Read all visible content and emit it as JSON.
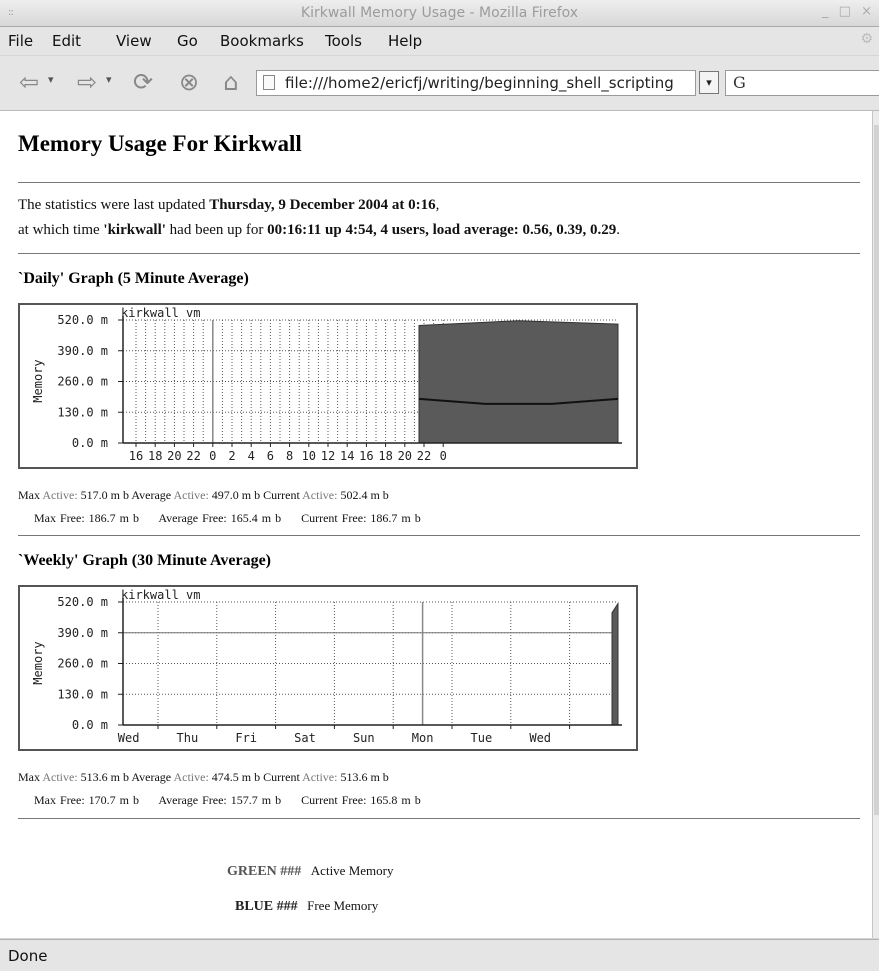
{
  "window": {
    "title": "Kirkwall Memory Usage - Mozilla Firefox"
  },
  "menu": [
    "File",
    "Edit",
    "View",
    "Go",
    "Bookmarks",
    "Tools",
    "Help"
  ],
  "address": {
    "url": "file:///home2/ericfj/writing/beginning_shell_scripting"
  },
  "page": {
    "title": "Memory Usage For Kirkwall",
    "updated_prefix": "The statistics were last updated ",
    "updated_date": "Thursday, 9 December 2004 at 0:16",
    "updated_suffix": ",",
    "uptime_prefix": "at which time ",
    "host": "'kirkwall'",
    "uptime_mid": " had been up for ",
    "uptime_value": "00:16:11 up 4:54, 4 users, load average: 0.56, 0.39, 0.29",
    "uptime_suffix": "."
  },
  "daily": {
    "heading": "`Daily' Graph (5 Minute Average)",
    "stats_line1": {
      "max_label": "Max",
      "max_tag": "Active:",
      "max_value": "517.0 m b",
      "avg_label": "Average",
      "avg_tag": "Active:",
      "avg_value": "497.0 m b",
      "cur_label": "Current",
      "cur_tag": "Active:",
      "cur_value": "502.4 m b"
    },
    "stats_line2": {
      "max_label": "Max",
      "max_tag": "Free:",
      "max_value": "186.7 m b",
      "avg_label": "Average",
      "avg_tag": "Free:",
      "avg_value": "165.4 m b",
      "cur_label": "Current",
      "cur_tag": "Free:",
      "cur_value": "186.7 m b"
    }
  },
  "weekly": {
    "heading": "`Weekly' Graph (30 Minute Average)",
    "stats_line1": {
      "max_label": "Max",
      "max_tag": "Active:",
      "max_value": "513.6 m b",
      "avg_label": "Average",
      "avg_tag": "Active:",
      "avg_value": "474.5 m b",
      "cur_label": "Current",
      "cur_tag": "Active:",
      "cur_value": "513.6 m b"
    },
    "stats_line2": {
      "max_label": "Max",
      "max_tag": "Free:",
      "max_value": "170.7 m b",
      "avg_label": "Average",
      "avg_tag": "Free:",
      "avg_value": "157.7 m b",
      "cur_label": "Current",
      "cur_tag": "Free:",
      "cur_value": "165.8 m b"
    }
  },
  "legend": {
    "green_key": "GREEN ###",
    "green_label": "Active Memory",
    "blue_key": "BLUE ###",
    "blue_label": "Free Memory"
  },
  "status": "Done",
  "chart_data": [
    {
      "type": "area",
      "title": "kirkwall vm",
      "ylabel": "Memory",
      "ylim": [
        0,
        520
      ],
      "y_ticks": [
        "520.0 m",
        "390.0 m",
        "260.0 m",
        "130.0 m",
        "0.0 m"
      ],
      "x_ticks": [
        "16",
        "18",
        "20",
        "22",
        "0",
        "2",
        "4",
        "6",
        "8",
        "10",
        "12",
        "14",
        "16",
        "18",
        "20",
        "22",
        "0"
      ],
      "grid": true,
      "series": [
        {
          "name": "Active Memory",
          "x_range": [
            "22",
            "0"
          ],
          "values": [
            497,
            517,
            502.4
          ]
        },
        {
          "name": "Free Memory",
          "x_range": [
            "22",
            "0"
          ],
          "values": [
            186.7,
            165.4,
            165.4,
            186.7
          ]
        }
      ]
    },
    {
      "type": "area",
      "title": "kirkwall vm",
      "ylabel": "Memory",
      "ylim": [
        0,
        520
      ],
      "y_ticks": [
        "520.0 m",
        "390.0 m",
        "260.0 m",
        "130.0 m",
        "0.0 m"
      ],
      "x_ticks": [
        "Wed",
        "Thu",
        "Fri",
        "Sat",
        "Sun",
        "Mon",
        "Tue",
        "Wed"
      ],
      "grid": true,
      "series": [
        {
          "name": "Active Memory",
          "x_range": [
            "Wed",
            "Wed"
          ],
          "values": [
            474.5,
            513.6
          ]
        }
      ]
    }
  ]
}
